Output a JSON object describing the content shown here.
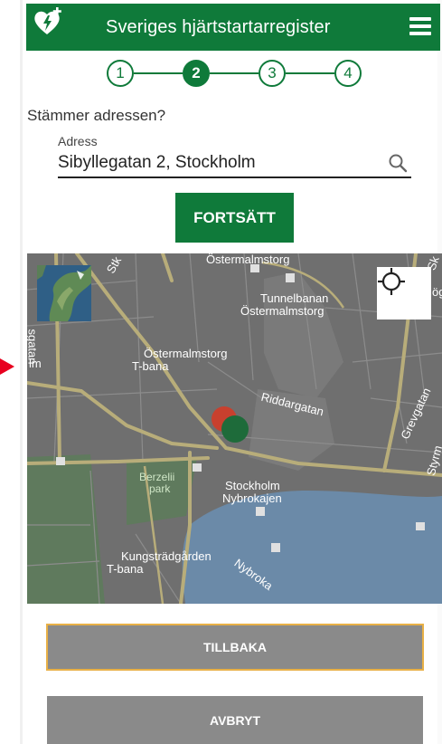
{
  "header": {
    "title": "Sveriges hjärtstartarregister",
    "logo_icon": "heart-defibrillator-icon",
    "menu_icon": "hamburger-menu-icon",
    "brand_color": "#0f7a3a"
  },
  "stepper": {
    "steps": [
      "1",
      "2",
      "3",
      "4"
    ],
    "active_step": 2
  },
  "address_form": {
    "question": "Stämmer adressen?",
    "label": "Adress",
    "value": "Sibyllegatan 2, Stockholm",
    "search_icon": "search-icon",
    "continue_label": "FORTSÄTT"
  },
  "map": {
    "layer_icon": "satellite-layer-icon",
    "locate_icon": "crosshair-locate-icon",
    "labels": {
      "ostermalmstorg_top": "Östermalmstorg",
      "tunnelbanan": "Tunnelbanan",
      "tunnelbanan_sub": "Östermalmstorg",
      "ostermalmstorg_station": "Östermalmstorg",
      "t_bana_1": "T-bana",
      "riddargatan": "Riddargatan",
      "grevgatan": "Grevgatan",
      "berzelii": "Berzelii",
      "park": "park",
      "stockholm": "Stockholm",
      "nybrokajen": "Nybrokajen",
      "kungstradgarden": "Kungsträdgården",
      "t_bana_2": "T-bana",
      "nybroka": "Nybroka",
      "sgatan": "sgatan",
      "lm": "lm",
      "styrm": "Styrm",
      "sk": "Sk",
      "stk": "Stk",
      "sc": "S",
      "eg": "ög"
    },
    "markers": {
      "red": "#c8402e",
      "green": "#1e6b3a"
    }
  },
  "footer": {
    "back_label": "TILLBAKA",
    "cancel_label": "AVBRYT"
  }
}
